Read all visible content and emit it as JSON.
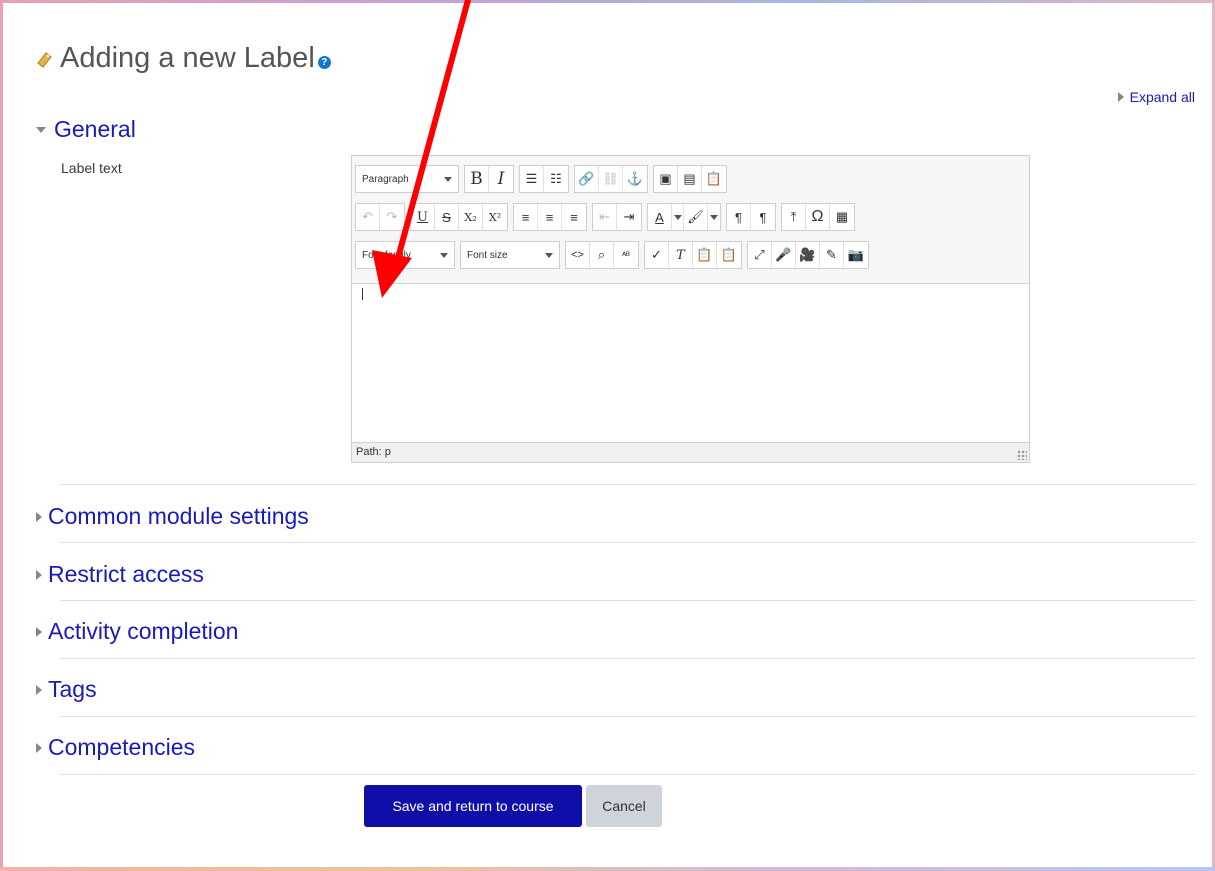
{
  "page": {
    "title": "Adding a new Label",
    "help_icon": "?"
  },
  "expand_all": "Expand all",
  "general": {
    "heading": "General",
    "field_label": "Label text"
  },
  "editor": {
    "toolbar_row1": {
      "paragraph_select": "Paragraph",
      "bold": "B",
      "italic": "I"
    },
    "toolbar_row2": {
      "underline": "U",
      "strikethrough": "S",
      "subscript": "X₂",
      "superscript": "X²",
      "pilcrow_ltr": "¶",
      "pilcrow_rtl": "¶",
      "omega": "Ω"
    },
    "toolbar_row3": {
      "font_family_select": "Font family",
      "font_size_select": "Font size",
      "code_view": "<>"
    },
    "status_path": "Path: p"
  },
  "sections": [
    {
      "label": "Common module settings"
    },
    {
      "label": "Restrict access"
    },
    {
      "label": "Activity completion"
    },
    {
      "label": "Tags"
    },
    {
      "label": "Competencies"
    }
  ],
  "buttons": {
    "save_return": "Save and return to course",
    "cancel": "Cancel"
  },
  "colors": {
    "link": "#1a1ab8",
    "primary": "#0f0fa8",
    "annotation_arrow": "#ff0000"
  }
}
